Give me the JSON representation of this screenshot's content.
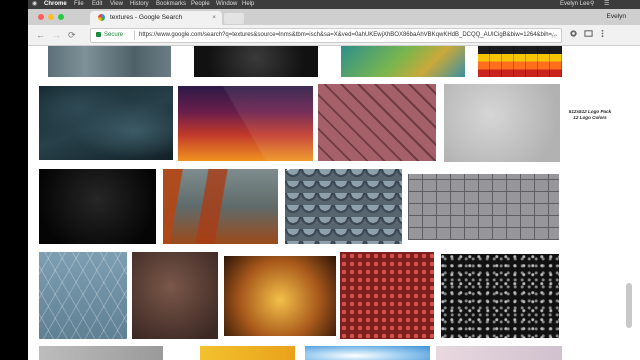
{
  "menubar": {
    "app": "Chrome",
    "items": [
      "File",
      "Edit",
      "View",
      "History",
      "Bookmarks",
      "People",
      "Window",
      "Help"
    ],
    "user": "Evelyn Lee"
  },
  "tab": {
    "title": "textures - Google Search",
    "close": "×"
  },
  "profile_name": "Evelyn",
  "toolbar": {
    "back": "←",
    "forward": "→",
    "reload": "⟳",
    "secure_label": "Secure",
    "url": "https://www.google.com/search?q=textures&source=lnms&tbm=isch&sa=X&ved=0ahUKEwjXhBOX86baAhVBKqwKHdB_DCQQ_AUICigB&biw=1264&bih=...",
    "star": "☆"
  },
  "logo_caption": [
    "512x512 Logo Pack",
    "12 Logo Colors"
  ],
  "images": [
    {
      "name": "metal-plate",
      "texture": "metal"
    },
    {
      "name": "dark-grunge",
      "texture": "dark1"
    },
    {
      "name": "teal-watercolor",
      "texture": "teal"
    },
    {
      "name": "lego-colors",
      "texture": "lego"
    },
    {
      "name": "dark-leather",
      "texture": "leather"
    },
    {
      "name": "geometric-sunset",
      "texture": "geo"
    },
    {
      "name": "herringbone-brick",
      "texture": "herring"
    },
    {
      "name": "white-concrete",
      "texture": "concrete"
    },
    {
      "name": "black-grain",
      "texture": "black"
    },
    {
      "name": "rusted-metal",
      "texture": "rust"
    },
    {
      "name": "slate-scales",
      "texture": "scales"
    },
    {
      "name": "cobblestone",
      "texture": "cobble"
    },
    {
      "name": "cracked-glass",
      "texture": "glass"
    },
    {
      "name": "brown-paper",
      "texture": "brown"
    },
    {
      "name": "amber-grunge",
      "texture": "amber"
    },
    {
      "name": "basketball-leather",
      "texture": "basket"
    },
    {
      "name": "black-speckle",
      "texture": "stars"
    },
    {
      "name": "gray-sand",
      "texture": "sand"
    },
    {
      "name": "yellow-paper",
      "texture": "yellow"
    },
    {
      "name": "blue-sky",
      "texture": "sky"
    },
    {
      "name": "pastel-fabric",
      "texture": "pastel"
    }
  ]
}
